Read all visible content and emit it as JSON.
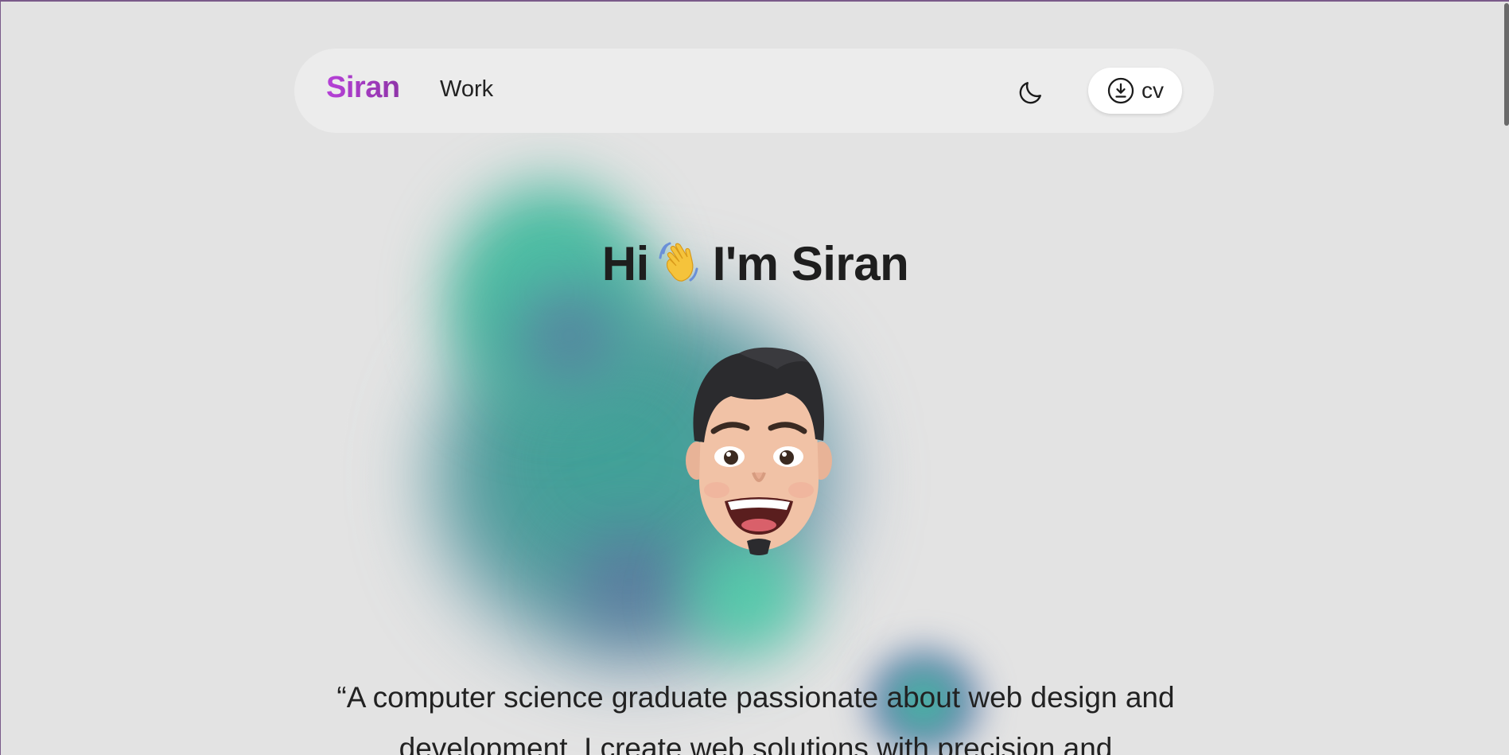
{
  "nav": {
    "brand": "Siran",
    "links": [
      {
        "label": "Work"
      }
    ],
    "theme_toggle_icon": "moon-icon",
    "cv_button": {
      "label": "cv",
      "icon": "download-icon"
    }
  },
  "hero": {
    "greeting_before": "Hi",
    "greeting_emoji": "👋",
    "greeting_after": "I'm Siran",
    "avatar_icon": "memoji-avatar-icon"
  },
  "bio": {
    "text": "“A computer science graduate passionate about web design and development. I create web solutions with precision and"
  },
  "colors": {
    "background": "#e3e3e3",
    "navbar": "#ececec",
    "brand_start": "#b640d8",
    "brand_end": "#8f35a8",
    "blob_green": "#4fc9a8",
    "blob_blue": "#5a6f9f",
    "text": "#1e1e1e"
  }
}
